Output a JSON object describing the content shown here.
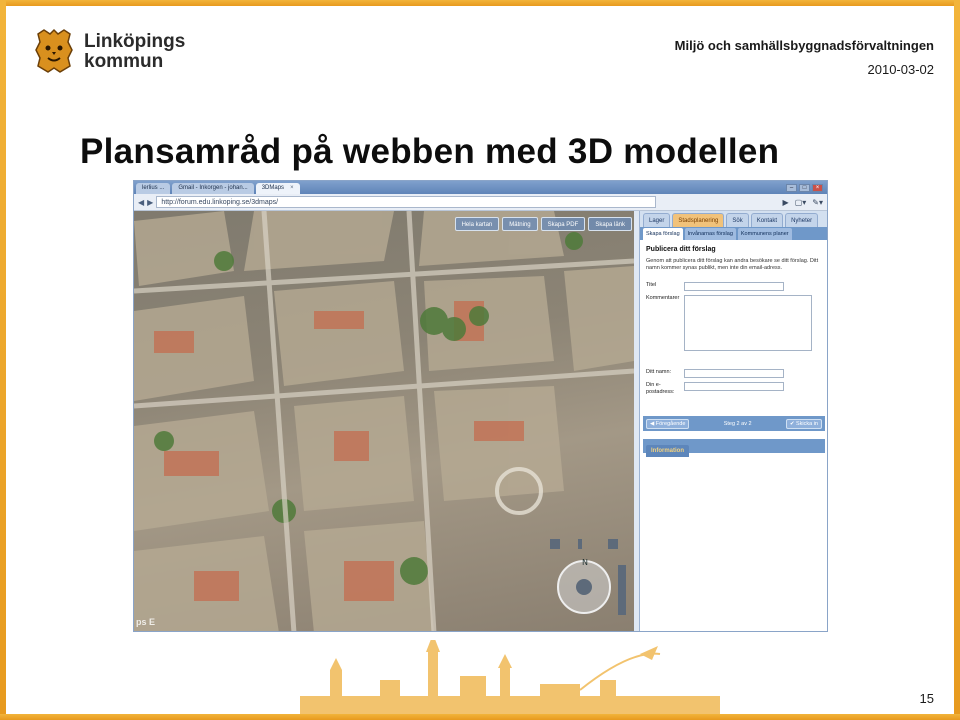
{
  "header": {
    "logo_line1": "Linköpings",
    "logo_line2": "kommun",
    "organization": "Miljö och samhällsbyggnadsförvaltningen",
    "date": "2010-03-02"
  },
  "title": "Plansamråd på webben med 3D modellen",
  "page_number": "15",
  "browser": {
    "tabs": [
      {
        "label": "lerlius ..."
      },
      {
        "label": "Gmail - Inkorgen - johan..."
      },
      {
        "label": "3DMaps",
        "active": true
      }
    ],
    "url": "http://forum.edu.linkoping.se/3dmaps/"
  },
  "map": {
    "toolbar": [
      "Hela kartan",
      "Mätning",
      "Skapa PDF",
      "Skapa länk"
    ],
    "watermark": "ps E"
  },
  "panel": {
    "tabs": [
      "Lager",
      "Stadsplanering",
      "Sök",
      "Kontakt",
      "Nyheter"
    ],
    "active_tab": "Stadsplanering",
    "subtabs": [
      "Skapa förslag",
      "Invånarnas förslag",
      "Kommunens planer"
    ],
    "active_subtab": "Skapa förslag",
    "form": {
      "heading": "Publicera ditt förslag",
      "description": "Genom att publicera ditt förslag kan andra besökare se ditt förslag. Ditt namn kommer synas publikt, men inte din email-adress.",
      "fields": {
        "title_label": "Titel",
        "comment_label": "Kommentarer",
        "name_label": "Ditt namn:",
        "email_label": "Din e-postadress:"
      }
    },
    "step": {
      "prev_label": "Föregående",
      "step_text": "Steg 2 av 2",
      "send_label": "Skicka in"
    },
    "info_tab": "Information"
  },
  "colors": {
    "frame": "#e79a1e",
    "panel_blue": "#6f98c9",
    "active_tab": "#f1c27a"
  }
}
